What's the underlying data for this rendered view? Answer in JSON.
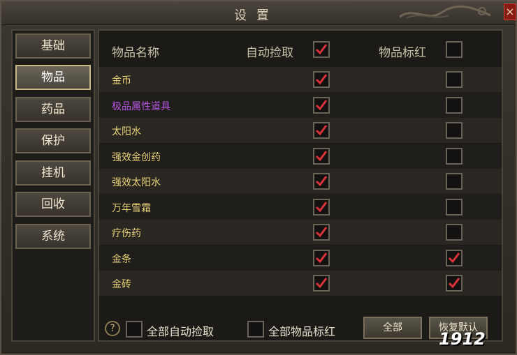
{
  "window": {
    "title": "设 置"
  },
  "tabs": [
    {
      "label": "基础",
      "active": false
    },
    {
      "label": "物品",
      "active": true
    },
    {
      "label": "药品",
      "active": false
    },
    {
      "label": "保护",
      "active": false
    },
    {
      "label": "挂机",
      "active": false
    },
    {
      "label": "回收",
      "active": false
    },
    {
      "label": "系统",
      "active": false
    }
  ],
  "table": {
    "headers": {
      "name": "物品名称",
      "auto_pickup": "自动捡取",
      "highlight": "物品标红"
    },
    "header_auto_pickup_checked": true,
    "header_highlight_checked": false,
    "rows": [
      {
        "name": "金币",
        "auto": true,
        "red": false,
        "color": "yellow"
      },
      {
        "name": "极品属性道具",
        "auto": true,
        "red": false,
        "color": "purple"
      },
      {
        "name": "太阳水",
        "auto": true,
        "red": false,
        "color": "yellow"
      },
      {
        "name": "强效金创药",
        "auto": true,
        "red": false,
        "color": "yellow"
      },
      {
        "name": "强效太阳水",
        "auto": true,
        "red": false,
        "color": "yellow"
      },
      {
        "name": "万年雪霜",
        "auto": true,
        "red": false,
        "color": "yellow"
      },
      {
        "name": "疗伤药",
        "auto": true,
        "red": false,
        "color": "yellow"
      },
      {
        "name": "金条",
        "auto": true,
        "red": true,
        "color": "yellow"
      },
      {
        "name": "金砖",
        "auto": true,
        "red": true,
        "color": "yellow"
      }
    ]
  },
  "bottom": {
    "all_auto_label": "全部自动捡取",
    "all_red_label": "全部物品标红",
    "all_button": "全部",
    "restore_button": "恢复默认"
  },
  "watermark": {
    "text": "1912"
  },
  "colors": {
    "check": "#d8333a",
    "item_name": "#e8d27a",
    "item_purple": "#b455e0"
  }
}
